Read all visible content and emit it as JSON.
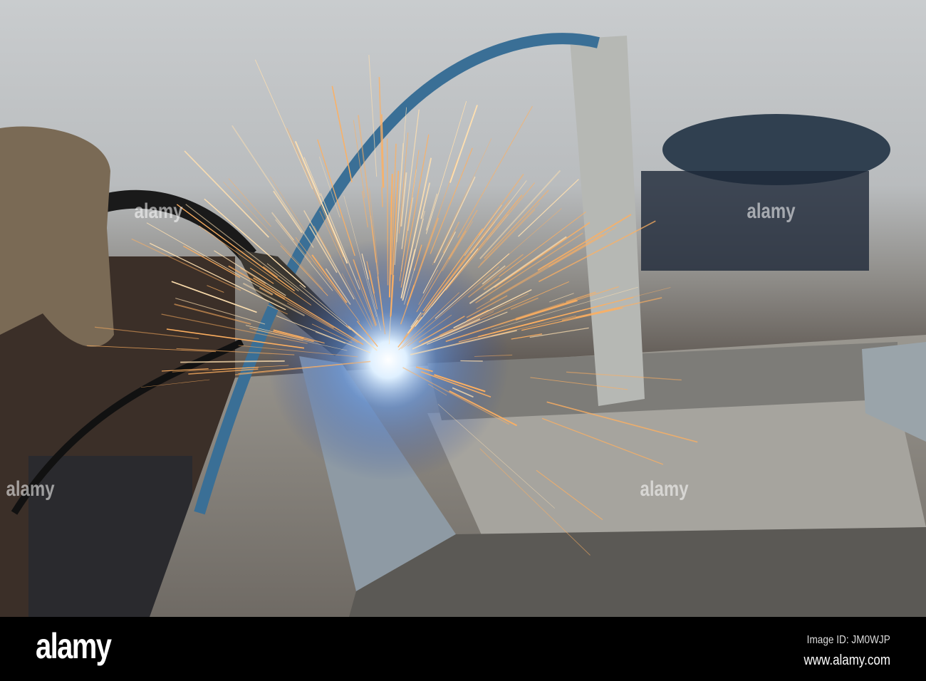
{
  "photo": {
    "subject": "welding",
    "watermark_text": "alamy"
  },
  "footer": {
    "logo": "alamy",
    "image_id": "Image ID: JM0WJP",
    "website": "www.alamy.com"
  },
  "colors": {
    "spark": "#ffb060",
    "arc_glow": "#cfe6ff",
    "background": "#000000"
  }
}
